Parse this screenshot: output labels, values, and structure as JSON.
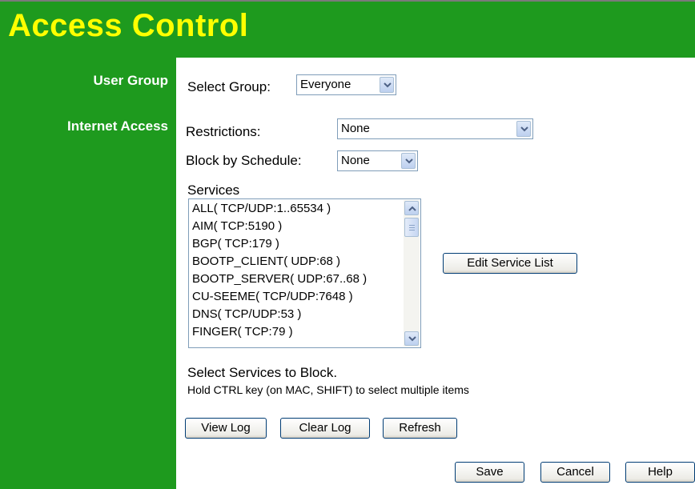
{
  "page": {
    "title": "Access Control"
  },
  "sidebar": {
    "user_group": "User Group",
    "internet_access": "Internet Access"
  },
  "user_group": {
    "label": "Select Group:",
    "value": "Everyone"
  },
  "internet_access": {
    "restrictions_label": "Restrictions:",
    "restrictions_value": "None",
    "schedule_label": "Block by Schedule:",
    "schedule_value": "None",
    "services_label": "Services",
    "services": [
      "ALL( TCP/UDP:1..65534 )",
      "AIM( TCP:5190 )",
      "BGP( TCP:179 )",
      "BOOTP_CLIENT( UDP:68 )",
      "BOOTP_SERVER( UDP:67..68 )",
      "CU-SEEME( TCP/UDP:7648 )",
      "DNS( TCP/UDP:53 )",
      "FINGER( TCP:79 )"
    ],
    "edit_service_list": "Edit Service List",
    "hint_main": "Select Services to Block.",
    "hint_sub": "Hold CTRL key (on MAC, SHIFT) to select multiple items"
  },
  "log_buttons": {
    "view_log": "View Log",
    "clear_log": "Clear Log",
    "refresh": "Refresh"
  },
  "footer_buttons": {
    "save": "Save",
    "cancel": "Cancel",
    "help": "Help"
  },
  "colors": {
    "header_bg": "#1e9a1e",
    "title_text": "#ffff00",
    "sidebar_text": "#ffffff"
  }
}
